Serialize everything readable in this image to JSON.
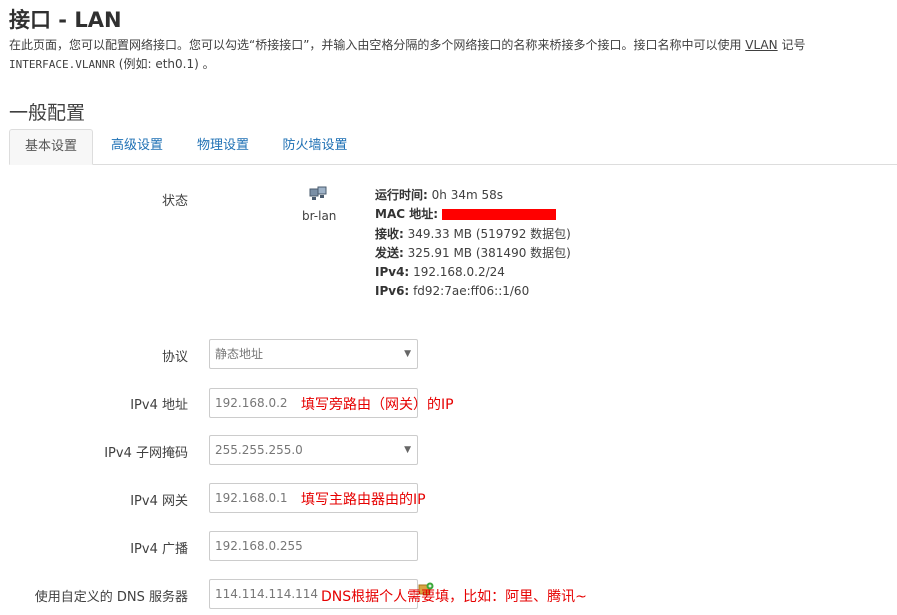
{
  "page": {
    "title": "接口 - LAN",
    "description_line1_a": "在此页面，您可以配置网络接口。您可以勾选“桥接接口”，并输入由空格分隔的多个网络接口的名称来桥接多个接口。接口名称中可以使用 ",
    "description_vlan": "VLAN",
    "description_line1_b": " 记号",
    "description_line2_mono": "INTERFACE.VLANNR",
    "description_line2_rest": " (例如: eth0.1) 。"
  },
  "section": {
    "title": "一般配置"
  },
  "tabs": [
    {
      "label": "基本设置",
      "active": true
    },
    {
      "label": "高级设置",
      "active": false
    },
    {
      "label": "物理设置",
      "active": false
    },
    {
      "label": "防火墙设置",
      "active": false
    }
  ],
  "status": {
    "label": "状态",
    "device": "br-lan",
    "icon": "ethernet-bridge-icon",
    "uptime_label": "运行时间:",
    "uptime_value": "0h 34m 58s",
    "mac_label": "MAC 地址:",
    "rx_label": "接收:",
    "rx_value": "349.33 MB (519792 数据包)",
    "tx_label": "发送:",
    "tx_value": "325.91 MB (381490 数据包)",
    "ipv4_label": "IPv4:",
    "ipv4_value": "192.168.0.2/24",
    "ipv6_label": "IPv6:",
    "ipv6_value": "fd92:7ae:ff06::1/60",
    "redaction_color": "#ff0000"
  },
  "form": {
    "protocol": {
      "label": "协议",
      "value": "静态地址"
    },
    "ipv4_addr": {
      "label": "IPv4 地址",
      "value": "192.168.0.2",
      "note": "填写旁路由（网关）的IP"
    },
    "netmask": {
      "label": "IPv4 子网掩码",
      "value": "255.255.255.0"
    },
    "gateway": {
      "label": "IPv4 网关",
      "value": "192.168.0.1",
      "note": "填写主路由器由的IP"
    },
    "broadcast": {
      "label": "IPv4 广播",
      "value": "192.168.0.255"
    },
    "dns": {
      "label": "使用自定义的 DNS 服务器",
      "value": "114.114.114.114",
      "note": "DNS根据个人需要填，比如：阿里、腾讯~"
    }
  },
  "colors": {
    "link": "#1e70b4",
    "annotation": "#e60000"
  }
}
